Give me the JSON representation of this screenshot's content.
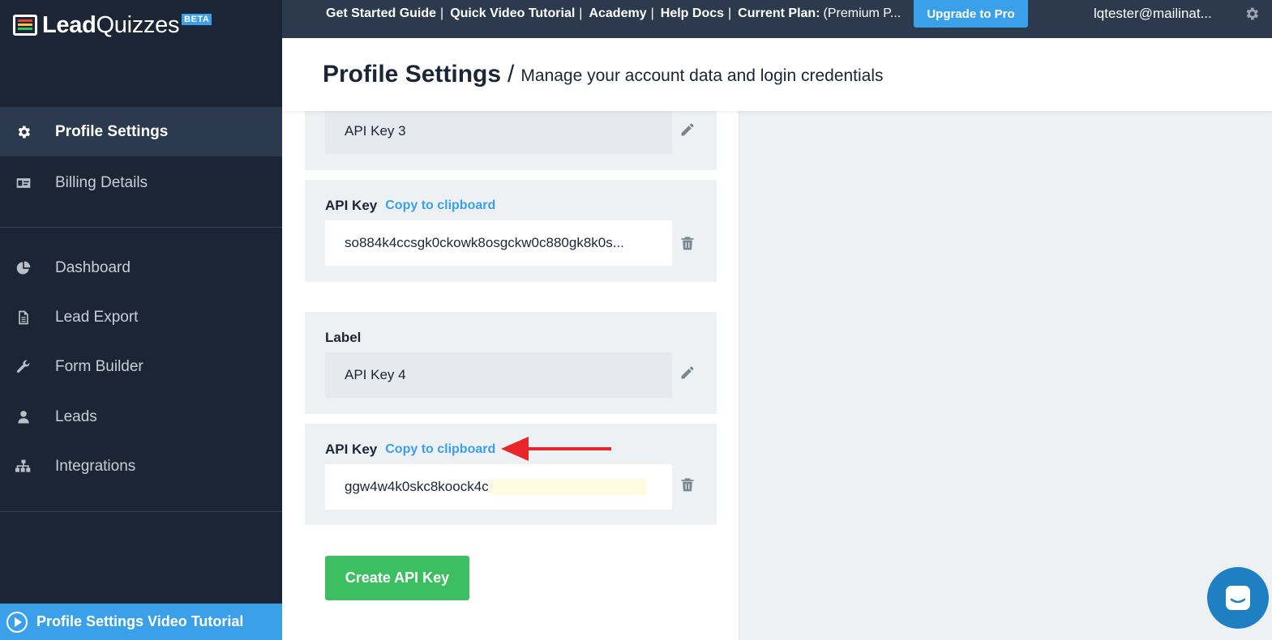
{
  "app": {
    "logo_bold": "Lead",
    "logo_light": "Quizzes",
    "badge": "BETA"
  },
  "topbar": {
    "links": [
      "Get Started Guide",
      "Quick Video Tutorial",
      "Academy",
      "Help Docs"
    ],
    "plan_label": "Current Plan:",
    "plan_value": "(Premium P...",
    "upgrade_label": "Upgrade to Pro",
    "user_email": "lqtester@mailinat..."
  },
  "sidebar": {
    "items": [
      {
        "label": "Profile Settings",
        "icon": "gear-icon",
        "active": true
      },
      {
        "label": "Billing Details",
        "icon": "id-card-icon"
      },
      {
        "label": "Dashboard",
        "icon": "pie-chart-icon"
      },
      {
        "label": "Lead Export",
        "icon": "document-icon"
      },
      {
        "label": "Form Builder",
        "icon": "wrench-icon"
      },
      {
        "label": "Leads",
        "icon": "user-icon"
      },
      {
        "label": "Integrations",
        "icon": "sitemap-icon"
      }
    ],
    "tutorial_label": "Profile Settings Video Tutorial"
  },
  "header": {
    "title": "Profile Settings",
    "separator": "/",
    "subtitle": "Manage your account data and login credentials"
  },
  "api_keys": [
    {
      "label_value": "API Key 3",
      "key_label": "API Key",
      "copy_label": "Copy to clipboard",
      "key_value": "so884k4ccsgk0ckowk8osgckw0c880gk8k0s..."
    },
    {
      "label_title": "Label",
      "label_value": "API Key 4",
      "key_label": "API Key",
      "copy_label": "Copy to clipboard",
      "key_value": "ggw4w4k0skc8koock4c"
    }
  ],
  "create_button": "Create API Key",
  "colors": {
    "sidebar": "#1c2536",
    "topbar": "#2d3a4e",
    "accent": "#3aa0ea",
    "create": "#3bbf60",
    "arrow": "#e8262a"
  }
}
